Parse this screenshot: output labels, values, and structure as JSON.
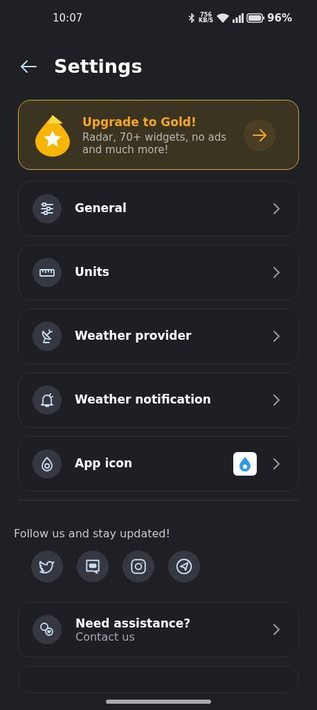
{
  "status_bar": {
    "time": "10:07",
    "net_speed": "756",
    "net_unit": "KB/S",
    "battery": "96%"
  },
  "header": {
    "title": "Settings"
  },
  "upgrade": {
    "title": "Upgrade to Gold!",
    "subtitle": "Radar, 70+ widgets, no ads and much more!"
  },
  "items": [
    {
      "label": "General",
      "kind": "plain"
    },
    {
      "label": "Units",
      "kind": "plain"
    },
    {
      "label": "Weather provider",
      "kind": "plain"
    },
    {
      "label": "Weather notification",
      "kind": "plain"
    },
    {
      "label": "App icon",
      "kind": "app_icon"
    }
  ],
  "follow": {
    "text": "Follow us and stay updated!",
    "links": [
      {
        "kind": "bird"
      },
      {
        "kind": "chat"
      },
      {
        "kind": "camera"
      },
      {
        "kind": "plane"
      }
    ]
  },
  "assistance": {
    "title": "Need assistance?",
    "subtitle": "Contact us"
  }
}
